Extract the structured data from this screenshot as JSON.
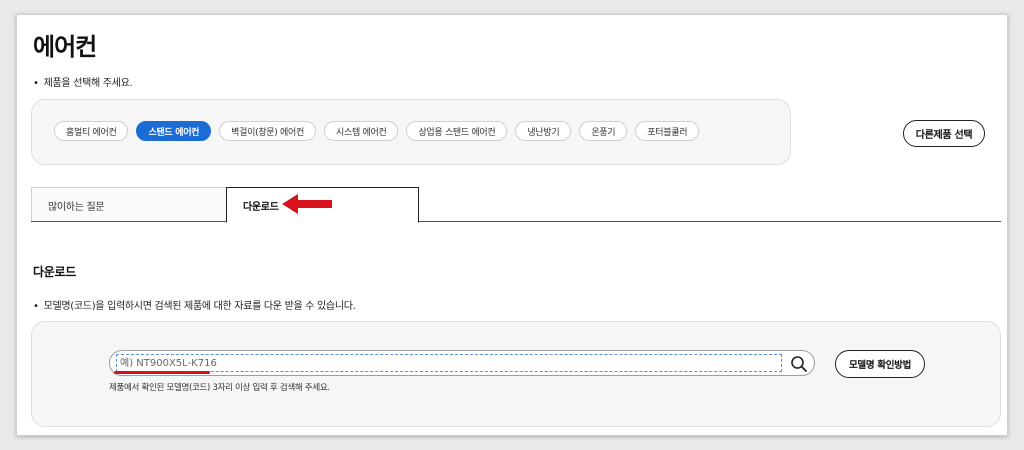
{
  "page_title": "에어컨",
  "product_instruction": "제품을 선택해 주세요.",
  "product_chips": [
    {
      "label": "홈멀티 에어컨",
      "active": false
    },
    {
      "label": "스탠드 에어컨",
      "active": true
    },
    {
      "label": "벽걸이(창문) 에어컨",
      "active": false
    },
    {
      "label": "시스템 에어컨",
      "active": false
    },
    {
      "label": "상업용 스탠드 에어컨",
      "active": false
    },
    {
      "label": "냉난방기",
      "active": false
    },
    {
      "label": "온풍기",
      "active": false
    },
    {
      "label": "포터블쿨러",
      "active": false
    }
  ],
  "other_product_button": "다른제품 선택",
  "tabs": [
    {
      "label": "많이하는 질문",
      "active": false
    },
    {
      "label": "다운로드",
      "active": true
    }
  ],
  "download": {
    "title": "다운로드",
    "instruction": "모델명(코드)을 입력하시면 검색된 제품에 대한 자료를 다운 받을 수 있습니다.",
    "search_placeholder": "예) NT900X5L-K716",
    "help_text": "제품에서 확인된 모델명(코드) 3자리 이상 입력 후 검색해 주세요.",
    "model_check_button": "모델명 확인방법"
  },
  "colors": {
    "accent_blue": "#1c6cd8",
    "annotation_red": "#d8121c"
  },
  "icons": {
    "search": "search-icon",
    "annotation_arrow": "red-arrow-icon"
  }
}
